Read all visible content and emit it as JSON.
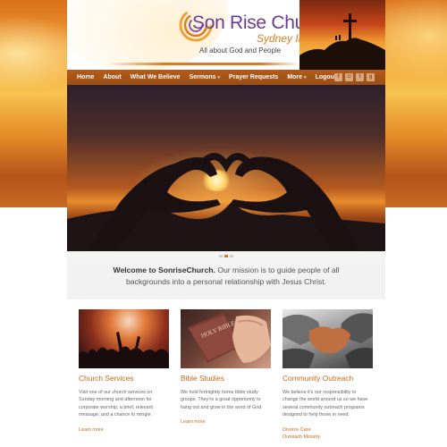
{
  "header": {
    "logo_title": "Son Rise Church",
    "logo_sub": "Sydney Inc.",
    "tagline": "All about God and People"
  },
  "nav": {
    "items": [
      {
        "label": "Home"
      },
      {
        "label": "About"
      },
      {
        "label": "What We Believe"
      },
      {
        "label": "Sermons",
        "dropdown": true
      },
      {
        "label": "Prayer Requests"
      },
      {
        "label": "More",
        "dropdown": true
      },
      {
        "label": "Logout"
      }
    ],
    "social": [
      {
        "icon": "facebook-icon",
        "glyph": "f"
      },
      {
        "icon": "instagram-icon",
        "glyph": "◘"
      },
      {
        "icon": "twitter-icon",
        "glyph": "t"
      },
      {
        "icon": "google-plus-icon",
        "glyph": "g"
      }
    ],
    "caret": "▾"
  },
  "welcome": {
    "lead": "Welcome to SonriseChurch.",
    "text": " Our mission is to guide people of all backgrounds into a personal relationship with Jesus Christ."
  },
  "cards": [
    {
      "title": "Church Services",
      "text": "Visit one of our church services on Sunday morning and afternoon for corporate worship, a brief, relevant message, and a chance to mingle.",
      "links": [
        "Learn more"
      ]
    },
    {
      "title": "Bible Studies",
      "text": "We hold fortnightly home bible study groups. They're a great opportunity to hang out and grow in the word of God",
      "links": [
        "Learn more"
      ]
    },
    {
      "title": "Community Outreach",
      "text": "We believe it's our responsibility to change the world around us so we have several community outreach programs designed to help those in need.",
      "links": [
        "Divorce Care",
        "Outreach Ministry"
      ]
    }
  ],
  "book_label": "HOLY BIBLE",
  "colors": {
    "accent": "#e07b1d",
    "nav_bg": "#a8551a",
    "logo_purple": "#6a3d90",
    "link": "#c8691c"
  },
  "slider": {
    "count": 3,
    "active": 1
  }
}
